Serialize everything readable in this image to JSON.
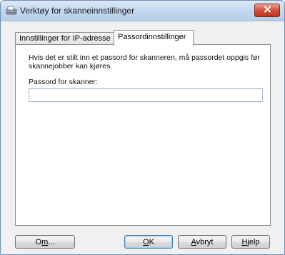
{
  "window": {
    "title": "Verktøy for skanneinnstillinger"
  },
  "icons": {
    "app": "scanner-settings-icon",
    "close": "close-icon"
  },
  "tabs": [
    {
      "label": "Innstillinger for IP-adresse",
      "active": false
    },
    {
      "label": "Passordinnstillinger",
      "active": true
    }
  ],
  "panel": {
    "description": "Hvis det er stilt inn et passord for skanneren, må passordet oppgis før skannejobber kan kjøres.",
    "password_label": "Passord for skanner:",
    "password_value": ""
  },
  "buttons": {
    "about": {
      "pre": "O",
      "key": "m",
      "post": "..."
    },
    "ok": {
      "pre": "",
      "key": "O",
      "post": "K"
    },
    "cancel": {
      "pre": "",
      "key": "A",
      "post": "vbryt"
    },
    "help": {
      "pre": "",
      "key": "H",
      "post": "jelp"
    }
  },
  "colors": {
    "titlebar": "#c4d8ee",
    "close_button": "#c0321c",
    "default_button_border": "#3c7fb1"
  }
}
